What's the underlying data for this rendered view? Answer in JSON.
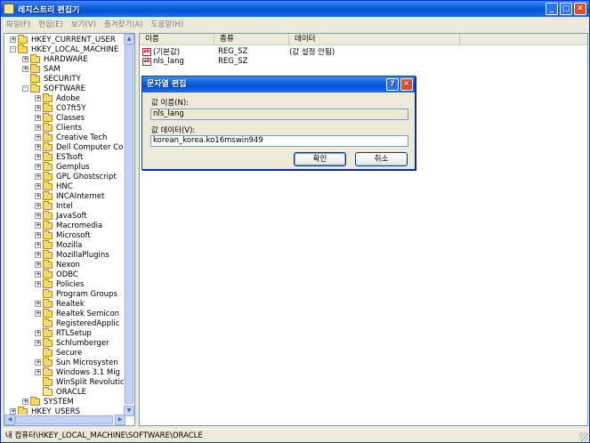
{
  "window": {
    "title": "레지스트리 편집기",
    "controls": {
      "minimize": "_",
      "maximize": "□",
      "close": "✕"
    }
  },
  "menu": [
    "파일(F)",
    "편집(E)",
    "보기(V)",
    "즐겨찾기(A)",
    "도움말(H)"
  ],
  "tree": {
    "items": [
      {
        "label": "HKEY_CURRENT_USER",
        "level": 1,
        "expander": "+"
      },
      {
        "label": "HKEY_LOCAL_MACHINE",
        "level": 1,
        "expander": "-"
      },
      {
        "label": "HARDWARE",
        "level": 2,
        "expander": "+"
      },
      {
        "label": "SAM",
        "level": 2,
        "expander": "+"
      },
      {
        "label": "SECURITY",
        "level": 2,
        "expander": ""
      },
      {
        "label": "SOFTWARE",
        "level": 2,
        "expander": "-"
      },
      {
        "label": "Adobe",
        "level": 3,
        "expander": "+"
      },
      {
        "label": "C07ft5Y",
        "level": 3,
        "expander": "+"
      },
      {
        "label": "Classes",
        "level": 3,
        "expander": "+"
      },
      {
        "label": "Clients",
        "level": 3,
        "expander": "+"
      },
      {
        "label": "Creative Tech",
        "level": 3,
        "expander": "+"
      },
      {
        "label": "Dell Computer Co",
        "level": 3,
        "expander": "+"
      },
      {
        "label": "ESTsoft",
        "level": 3,
        "expander": "+"
      },
      {
        "label": "Gemplus",
        "level": 3,
        "expander": "+"
      },
      {
        "label": "GPL Ghostscript",
        "level": 3,
        "expander": "+"
      },
      {
        "label": "HNC",
        "level": 3,
        "expander": "+"
      },
      {
        "label": "INCAInternet",
        "level": 3,
        "expander": "+"
      },
      {
        "label": "Intel",
        "level": 3,
        "expander": "+"
      },
      {
        "label": "JavaSoft",
        "level": 3,
        "expander": "+"
      },
      {
        "label": "Macromedia",
        "level": 3,
        "expander": "+"
      },
      {
        "label": "Microsoft",
        "level": 3,
        "expander": "+"
      },
      {
        "label": "Mozilla",
        "level": 3,
        "expander": "+"
      },
      {
        "label": "MozillaPlugins",
        "level": 3,
        "expander": "+"
      },
      {
        "label": "Nexon",
        "level": 3,
        "expander": "+"
      },
      {
        "label": "ODBC",
        "level": 3,
        "expander": "+"
      },
      {
        "label": "Policies",
        "level": 3,
        "expander": "+"
      },
      {
        "label": "Program Groups",
        "level": 3,
        "expander": ""
      },
      {
        "label": "Realtek",
        "level": 3,
        "expander": "+"
      },
      {
        "label": "Realtek Semicon",
        "level": 3,
        "expander": "+"
      },
      {
        "label": "RegisteredApplic",
        "level": 3,
        "expander": ""
      },
      {
        "label": "RTLSetup",
        "level": 3,
        "expander": "+"
      },
      {
        "label": "Schlumberger",
        "level": 3,
        "expander": "+"
      },
      {
        "label": "Secure",
        "level": 3,
        "expander": ""
      },
      {
        "label": "Sun Microsysten",
        "level": 3,
        "expander": "+"
      },
      {
        "label": "Windows 3.1 Mig",
        "level": 3,
        "expander": "+"
      },
      {
        "label": "WinSplit Revolutic",
        "level": 3,
        "expander": ""
      },
      {
        "label": "ORACLE",
        "level": 3,
        "expander": "",
        "open": true
      },
      {
        "label": "SYSTEM",
        "level": 2,
        "expander": "+"
      },
      {
        "label": "HKEY_USERS",
        "level": 1,
        "expander": "+"
      }
    ]
  },
  "list": {
    "columns": [
      "이름",
      "종류",
      "데이터"
    ],
    "rows": [
      {
        "name": "(기본값)",
        "type": "REG_SZ",
        "data": "(값 설정 안됨)"
      },
      {
        "name": "nls_lang",
        "type": "REG_SZ",
        "data": ""
      }
    ]
  },
  "dialog": {
    "title": "문자열 편집",
    "help": "?",
    "close": "✕",
    "name_label": "값 이름(N):",
    "name_value": "nls_lang",
    "data_label": "값 데이터(V):",
    "data_value": "korean_korea.ko16mswin949",
    "ok": "확인",
    "cancel": "취소"
  },
  "status": "내 컴퓨터\\HKEY_LOCAL_MACHINE\\SOFTWARE\\ORACLE"
}
